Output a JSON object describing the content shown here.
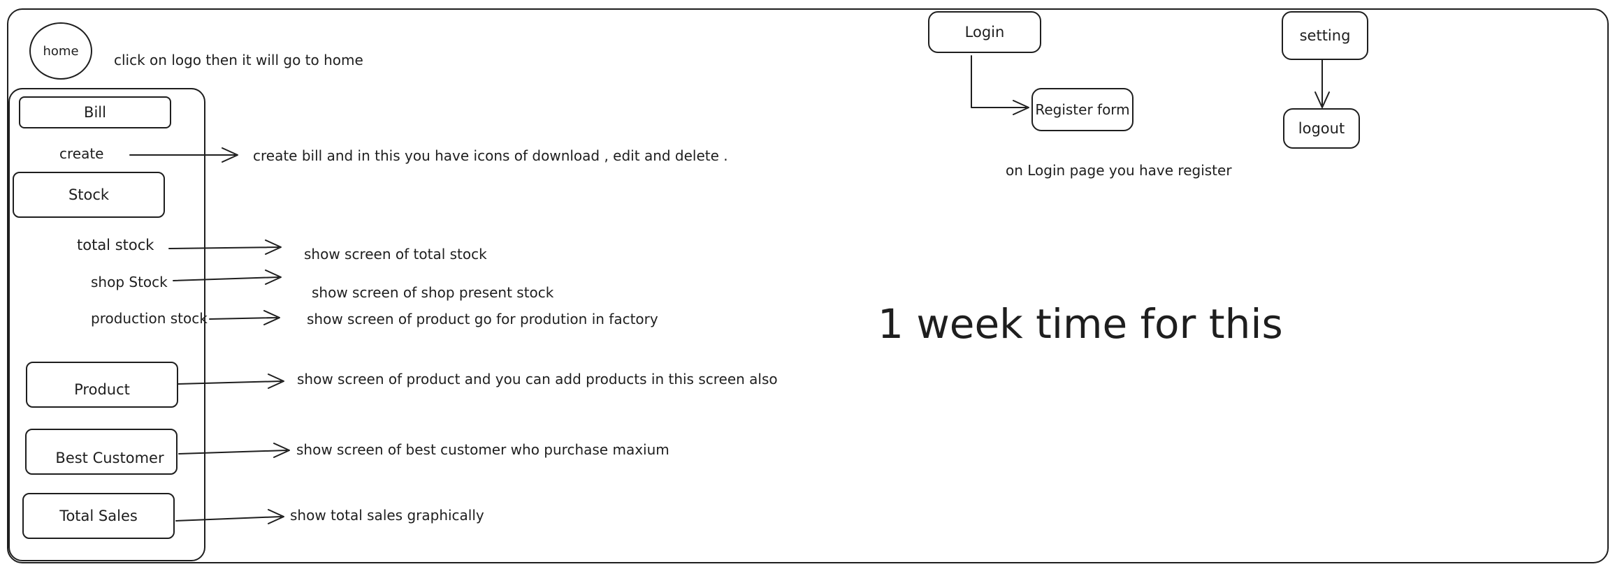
{
  "home": {
    "label": "home",
    "note": "click on logo then it will go to home"
  },
  "sidebar": {
    "bill": "Bill",
    "create": "create",
    "stock": "Stock",
    "total_stock": "total stock",
    "shop_stock": "shop Stock",
    "production_stock": "production stock",
    "product": "Product",
    "best_customer": "Best Customer",
    "total_sales": "Total Sales"
  },
  "notes": {
    "create": "create bill and in this you have icons of download , edit and delete .",
    "total_stock": "show screen of total stock",
    "shop_stock": "show screen of  shop present stock",
    "production_stock": "show screen of product go for prodution in factory",
    "product": "show screen of product and you can add products in this screen also",
    "best_customer": "show screen of best customer who purchase maxium",
    "total_sales": "show total sales graphically"
  },
  "auth": {
    "login": "Login",
    "register_form": "Register form",
    "note": "on Login page  you have register",
    "setting": "setting",
    "logout": "logout"
  },
  "headline": "1 week time  for this"
}
